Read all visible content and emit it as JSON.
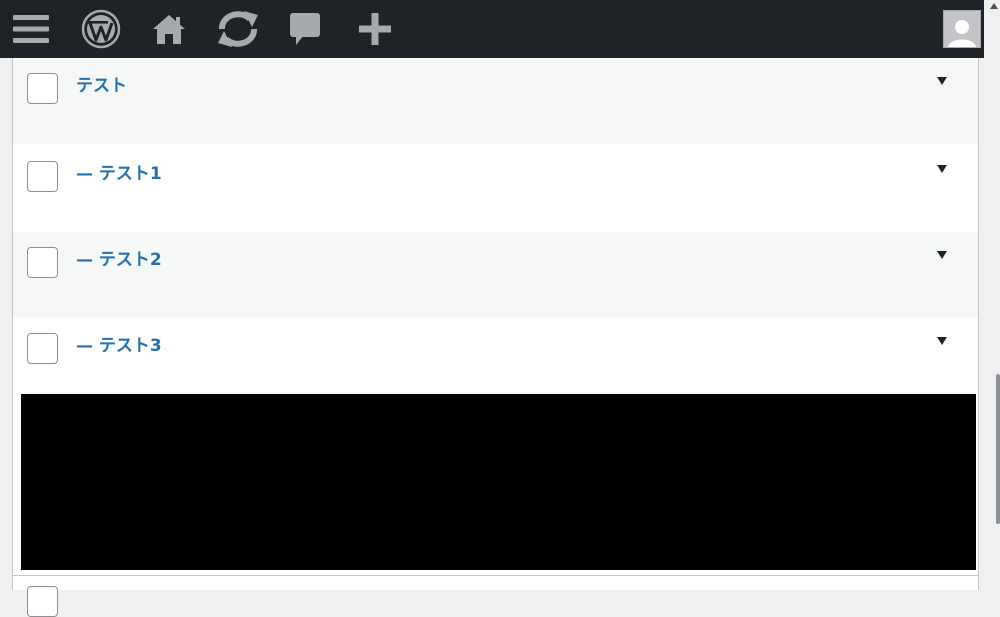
{
  "adminbar": {
    "background": "#1d2327",
    "icons": [
      "menu-icon",
      "wordpress-logo-icon",
      "home-icon",
      "updates-icon",
      "comments-icon",
      "plus-icon",
      "avatar-icon"
    ]
  },
  "rows": [
    {
      "title": "テスト"
    },
    {
      "title": "— テスト1"
    },
    {
      "title": "— テスト2"
    },
    {
      "title": "— テスト3"
    }
  ],
  "colors": {
    "link": "#2271b1",
    "row_alt": "#f6f7f7",
    "redaction": "#000000"
  }
}
